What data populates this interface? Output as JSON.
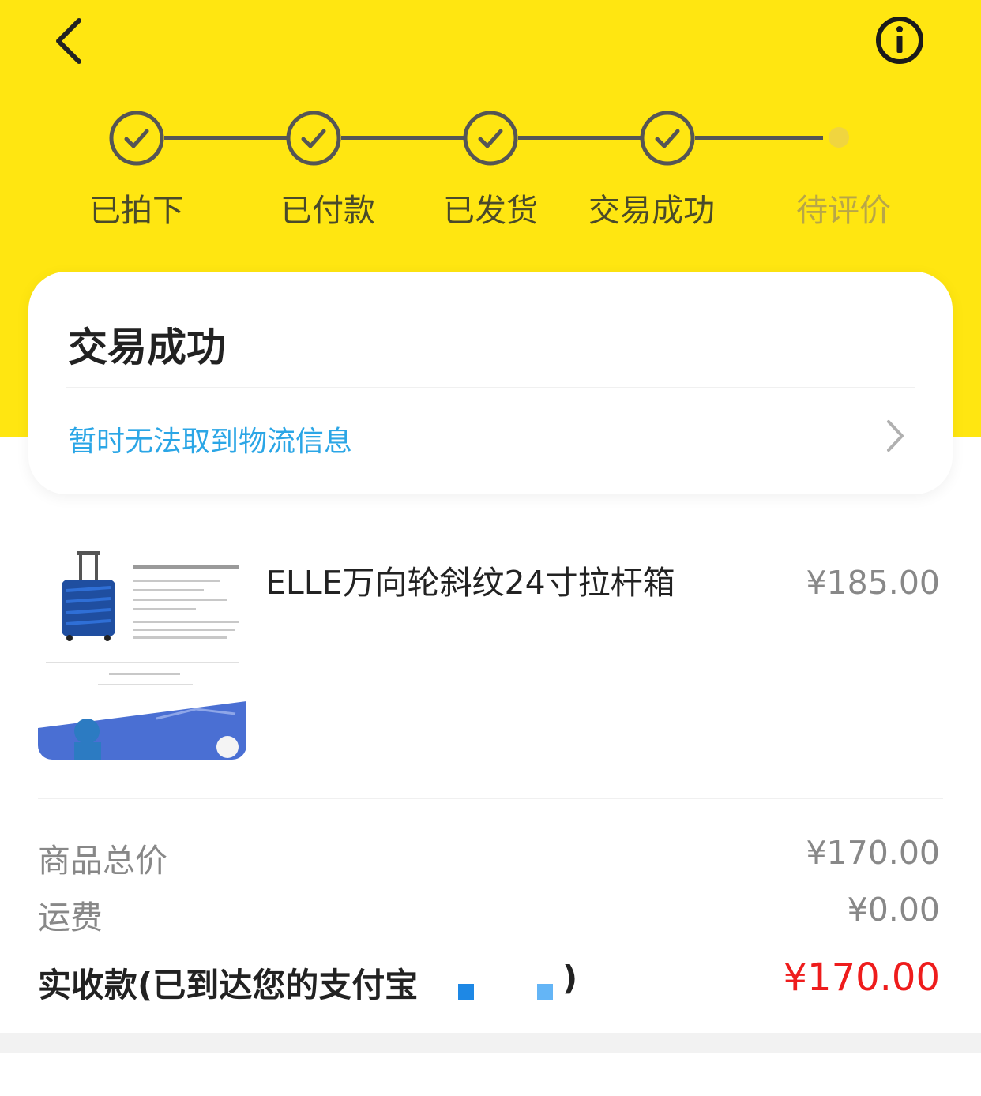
{
  "progress": {
    "steps": [
      {
        "label": "已拍下",
        "done": true
      },
      {
        "label": "已付款",
        "done": true
      },
      {
        "label": "已发货",
        "done": true
      },
      {
        "label": "交易成功",
        "done": true
      },
      {
        "label": "待评价",
        "done": false
      }
    ]
  },
  "status": {
    "title": "交易成功",
    "logistics": "暂时无法取到物流信息"
  },
  "product": {
    "image_icon": "suitcase-product-image",
    "title": "ELLE万向轮斜纹24寸拉杆箱",
    "price": "¥185.00"
  },
  "summary": {
    "subtotal_label": "商品总价",
    "subtotal_value": "¥170.00",
    "shipping_label": "运费",
    "shipping_value": "¥0.00",
    "total_label": "实收款(已到达您的支付宝",
    "total_label_end": ")",
    "total_value": "¥170.00"
  },
  "colors": {
    "header": "#ffe611",
    "accent_link": "#2ba6e6",
    "price_red": "#ee1c1c"
  }
}
